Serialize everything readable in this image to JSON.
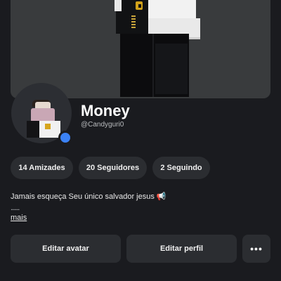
{
  "profile": {
    "display_name": "Money",
    "username": "@Candyguri0",
    "presence_color": "#3b82f6"
  },
  "stats": [
    {
      "label": "14 Amizades"
    },
    {
      "label": "20 Seguidores"
    },
    {
      "label": "2 Seguindo"
    }
  ],
  "bio": {
    "text": "Jamais esqueça Seu único salvador jesus 📢",
    "dots": "......",
    "more_label": "mais"
  },
  "actions": {
    "edit_avatar_label": "Editar avatar",
    "edit_profile_label": "Editar perfil",
    "more_icon": "•••"
  }
}
